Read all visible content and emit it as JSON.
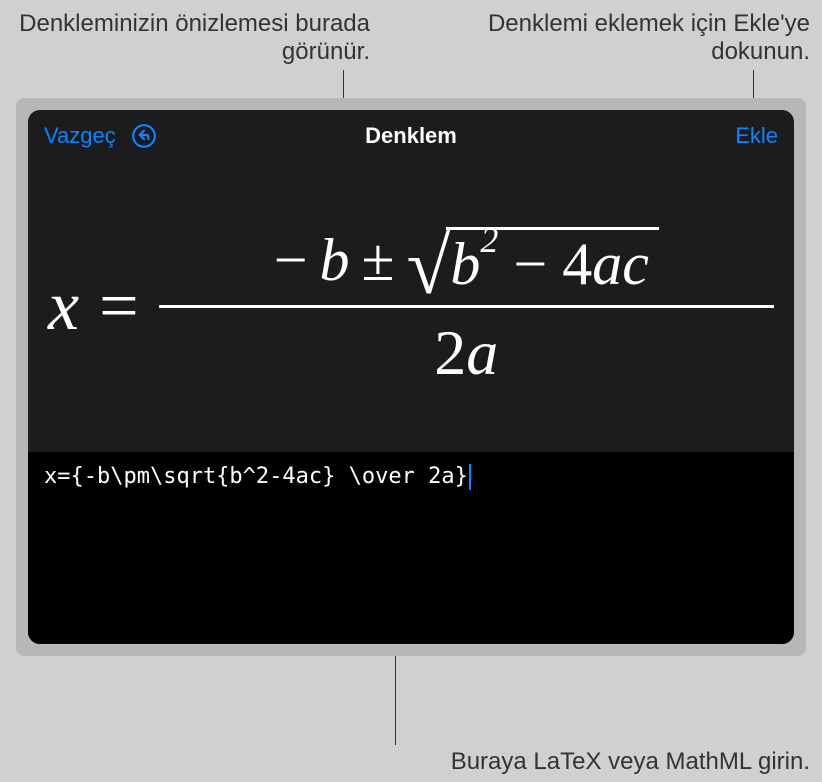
{
  "callouts": {
    "preview": "Denkleminizin önizlemesi burada görünür.",
    "insert": "Denklemi eklemek için Ekle'ye dokunun.",
    "input": "Buraya LaTeX veya MathML girin."
  },
  "header": {
    "cancel_label": "Vazgeç",
    "title": "Denklem",
    "insert_label": "Ekle"
  },
  "equation": {
    "latex_source": "x={-b\\pm\\sqrt{b^2-4ac} \\over 2a}",
    "preview_parts": {
      "lhs": "x",
      "equals": "=",
      "neg": "−",
      "b": "b",
      "pm": "±",
      "sqrt_b": "b",
      "sqrt_exp": "2",
      "sqrt_minus": "−",
      "sqrt_4ac_4": "4",
      "sqrt_4ac_a": "a",
      "sqrt_4ac_c": "c",
      "denom_2": "2",
      "denom_a": "a"
    }
  },
  "colors": {
    "accent": "#0a84ff",
    "dialog_bg": "#1c1c1e",
    "input_bg": "#000000",
    "text": "#ffffff"
  }
}
